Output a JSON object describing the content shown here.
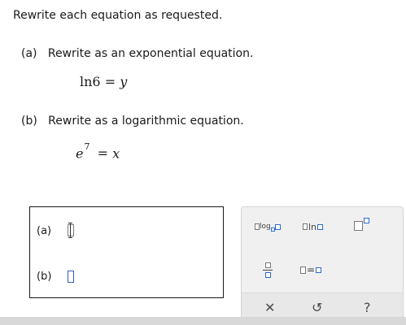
{
  "instructions": "Rewrite each equation as requested.",
  "part_a": {
    "label": "(a)",
    "prompt": "Rewrite as an exponential equation.",
    "equation_lhs": "ln6",
    "equation_op": "=",
    "equation_rhs": "y"
  },
  "part_b": {
    "label": "(b)",
    "prompt": "Rewrite as a logarithmic equation.",
    "equation_base": "e",
    "equation_exponent": "7",
    "equation_op": "=",
    "equation_rhs": "x"
  },
  "answer": {
    "label_a": "(a)",
    "label_b": "(b)"
  },
  "toolbar": {
    "log_text": "log",
    "ln_text": "ln",
    "equals_text": "=",
    "clear_symbol": "✕",
    "undo_symbol": "↺",
    "help_symbol": "?",
    "icons": [
      "log-template-icon",
      "ln-template-icon",
      "superscript-icon",
      "fraction-icon",
      "equals-icon",
      "clear-icon",
      "undo-icon",
      "help-icon"
    ]
  },
  "colors": {
    "input_border": "#2f5cc4",
    "template_box": "#2a6ad0",
    "toolbar_bg": "#f0f0f0",
    "toolbar_action_bg": "#e8e8e8"
  }
}
